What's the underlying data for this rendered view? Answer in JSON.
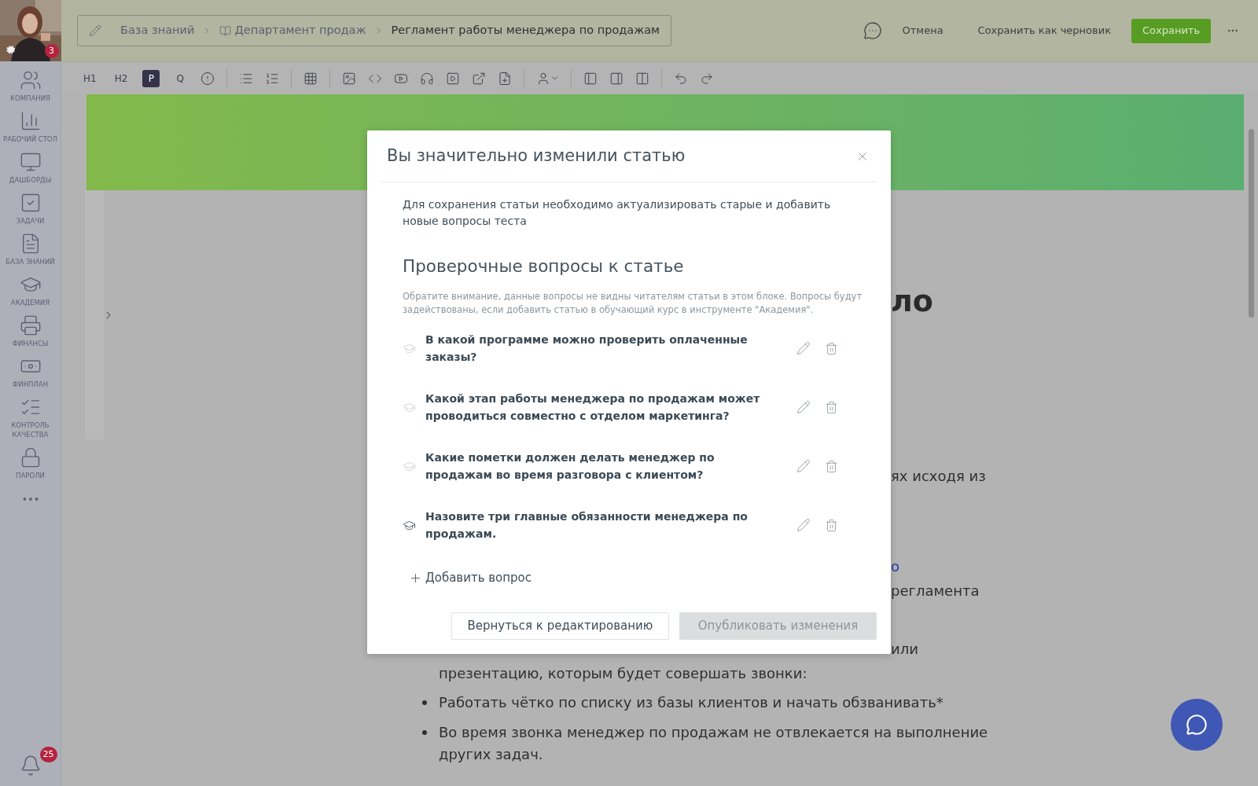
{
  "sidebar": {
    "avatar": {
      "badge": "3"
    },
    "items": [
      {
        "label": "КОМПАНИЯ",
        "kind": "company"
      },
      {
        "label": "РАБОЧИЙ СТОЛ",
        "kind": "desk"
      },
      {
        "label": "ДАШБОРДЫ",
        "kind": "dashboards"
      },
      {
        "label": "ЗАДАЧИ",
        "kind": "tasks"
      },
      {
        "label": "БАЗА ЗНАНИЙ",
        "kind": "knowledge"
      },
      {
        "label": "АКАДЕМИЯ",
        "kind": "academy"
      },
      {
        "label": "ФИНАНСЫ",
        "kind": "finance"
      },
      {
        "label": "ФИНПЛАН",
        "kind": "finplan"
      },
      {
        "label": "КОНТРОЛЬ КАЧЕСТВА",
        "kind": "quality"
      },
      {
        "label": "ПАРОЛИ",
        "kind": "passwords"
      }
    ],
    "notifications": {
      "badge": "25"
    }
  },
  "breadcrumb": [
    {
      "label": "База знаний",
      "kind": "plain"
    },
    {
      "label": "Департамент продаж",
      "kind": "book"
    },
    {
      "label": "Регламент работы менеджера по продажам",
      "kind": "current"
    }
  ],
  "actions": {
    "cancel": "Отмена",
    "draft": "Сохранить как черновик",
    "save": "Сохранить"
  },
  "format_buttons": [
    {
      "label": "H1",
      "selected": false
    },
    {
      "label": "H2",
      "selected": false
    },
    {
      "label": "P",
      "selected": true
    },
    {
      "label": "Q",
      "selected": false
    }
  ],
  "article": [
    {
      "kind": "heading",
      "text": "ло"
    },
    {
      "kind": "text",
      "text": "ях исходя из"
    },
    {
      "kind": "link",
      "text": "о"
    },
    {
      "kind": "text",
      "text": "регламента"
    },
    {
      "kind": "text",
      "text": "или"
    },
    {
      "kind": "line",
      "text": "презентацию, которым будет совершать звонки:"
    },
    {
      "kind": "bullet",
      "text": "Работать чётко по списку из базы клиентов и начать обзванивать*"
    },
    {
      "kind": "bullet",
      "text": "Во время звонка менеджер по продажам не отвлекается на выполнение"
    },
    {
      "kind": "line",
      "text": "других задач."
    }
  ],
  "modal": {
    "title": "Вы значительно изменили статью",
    "intro": "Для сохранения статьи необходимо актуализировать старые и добавить новые вопросы теста",
    "section_title": "Проверочные вопросы к статье",
    "note": "Обратите внимание, данные вопросы не видны читателям статьи в этом блоке. Вопросы будут задействованы, если добавить статью в обучающий курс в инструменте \"Академия\".",
    "questions": [
      {
        "text": "В какой программе можно проверить оплаченные заказы?",
        "hovered": false
      },
      {
        "text": "Какой этап работы менеджера по продажам может проводиться совместно с отделом маркетинга?",
        "hovered": false
      },
      {
        "text": "Какие пометки должен делать менеджер по продажам во время разговора с клиентом?",
        "hovered": false
      },
      {
        "text": "Назовите три главные обязанности менеджера по продажам.",
        "hovered": true
      }
    ],
    "add_button": "Добавить вопрос",
    "back_button": "Вернуться к редактированию",
    "publish_button": {
      "label": "Опубликовать изменения",
      "disabled": true
    }
  }
}
